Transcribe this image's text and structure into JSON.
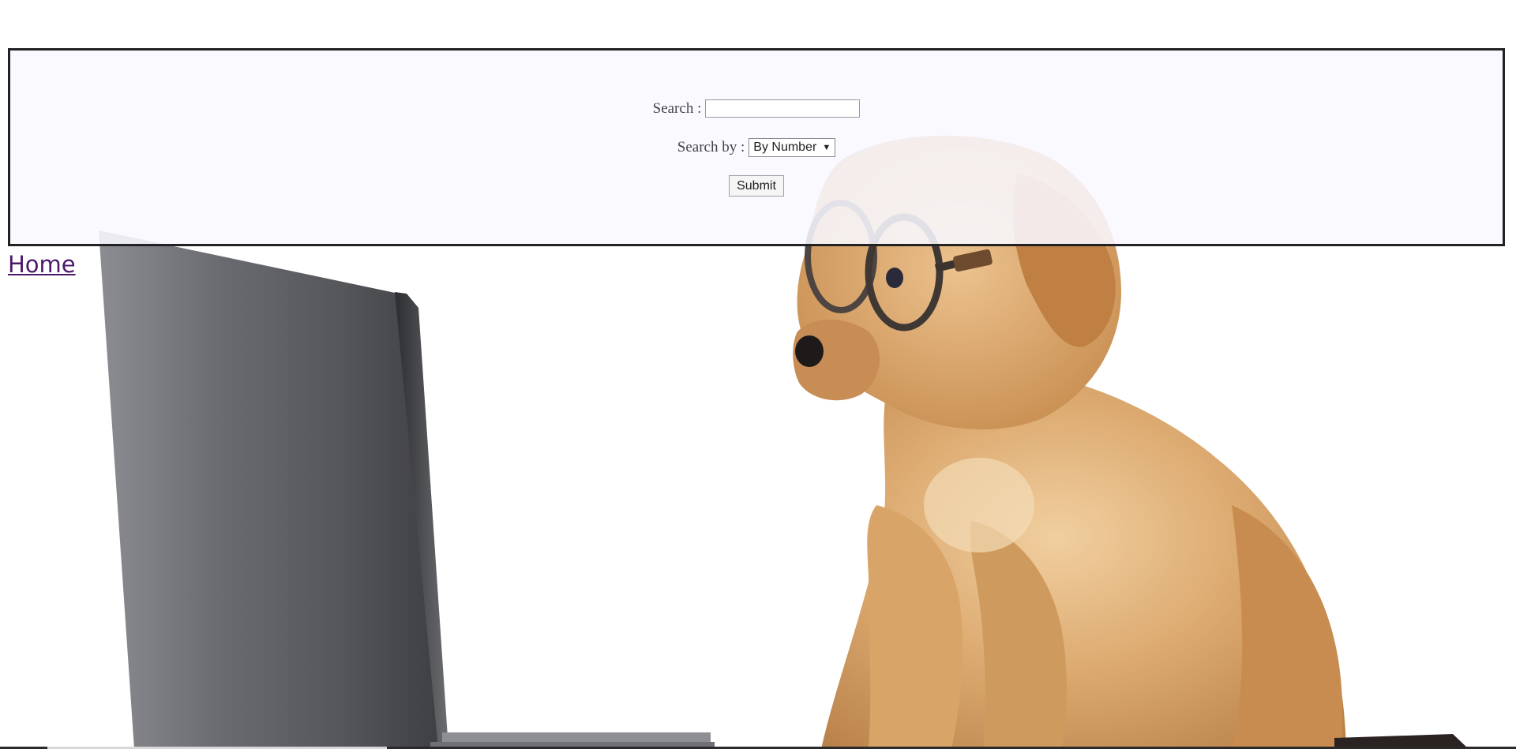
{
  "search_panel": {
    "search_label": "Search :",
    "search_value": "",
    "search_by_label": "Search by :",
    "search_by_selected": "By Number",
    "submit_label": "Submit"
  },
  "nav": {
    "home_label": "Home"
  },
  "background": {
    "description_icon": "puppy-with-glasses-photo",
    "colors": {
      "laptop": "#5f6064",
      "puppy": "#d7a46a"
    }
  }
}
